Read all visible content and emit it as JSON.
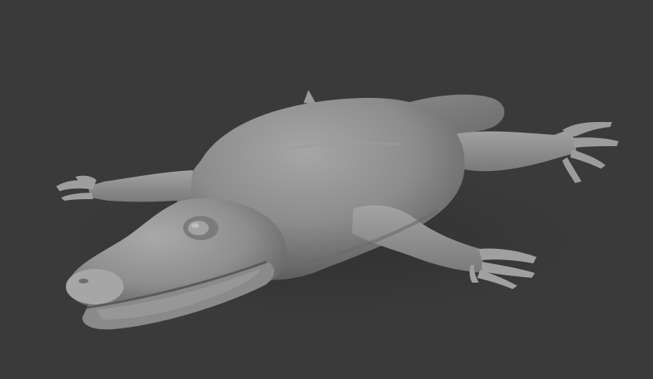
{
  "viewport": {
    "background": "#3a3a3a",
    "subject": "sculpted-gray-lizard-model",
    "material_color": "#8f8f8f"
  }
}
